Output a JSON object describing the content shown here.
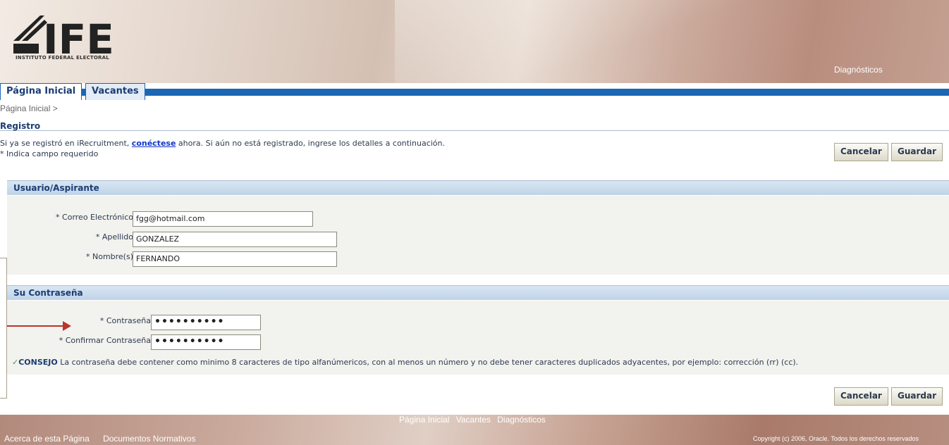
{
  "header": {
    "logo_text": "IFE",
    "org_name": "INSTITUTO FEDERAL ELECTORAL",
    "global_link": "Diagnósticos"
  },
  "tabs": [
    {
      "label": "Página Inicial",
      "active": true
    },
    {
      "label": "Vacantes",
      "active": false
    }
  ],
  "breadcrumb": "Página Inicial  >",
  "page_title": "Registro",
  "intro": {
    "before": "Si ya se registró en iRecruitment, ",
    "link": "conéctese",
    "after": " ahora. Si aún no está registrado, ingrese los detalles a continuación.",
    "required_note": "* Indica campo requerido"
  },
  "buttons": {
    "cancel": "Cancelar",
    "save": "Guardar"
  },
  "section_user": {
    "title": "Usuario/Aspirante",
    "fields": [
      {
        "label": "* Correo Electrónico",
        "value": "fgg@hotmail.com"
      },
      {
        "label": "* Apellido",
        "value": "GONZALEZ"
      },
      {
        "label": "* Nombre(s)",
        "value": "FERNANDO"
      }
    ]
  },
  "section_password": {
    "title": "Su Contraseña",
    "fields": [
      {
        "label": "* Contraseña",
        "value": "••••••••••"
      },
      {
        "label": "* Confirmar Contraseña",
        "value": "••••••••••"
      }
    ],
    "tip_label": "CONSEJO",
    "tip_text": " La contraseña debe contener como minimo 8 caracteres de tipo alfanúmericos, con al menos un número y no debe tener caracteres duplicados adyacentes, por ejemplo: corrección (rr) (cc)."
  },
  "footer": {
    "center_links": [
      "Página Inicial",
      "Vacantes",
      "Diagnósticos"
    ],
    "left_links": [
      "Acerca de esta Página",
      "Documentos Normativos"
    ],
    "copyright": "Copyright (c) 2006, Oracle. Todos los derechos reservados"
  },
  "colors": {
    "brand_blue": "#1c67b4",
    "heading_blue": "#1b3d73",
    "annotation_red": "#b8362c"
  }
}
